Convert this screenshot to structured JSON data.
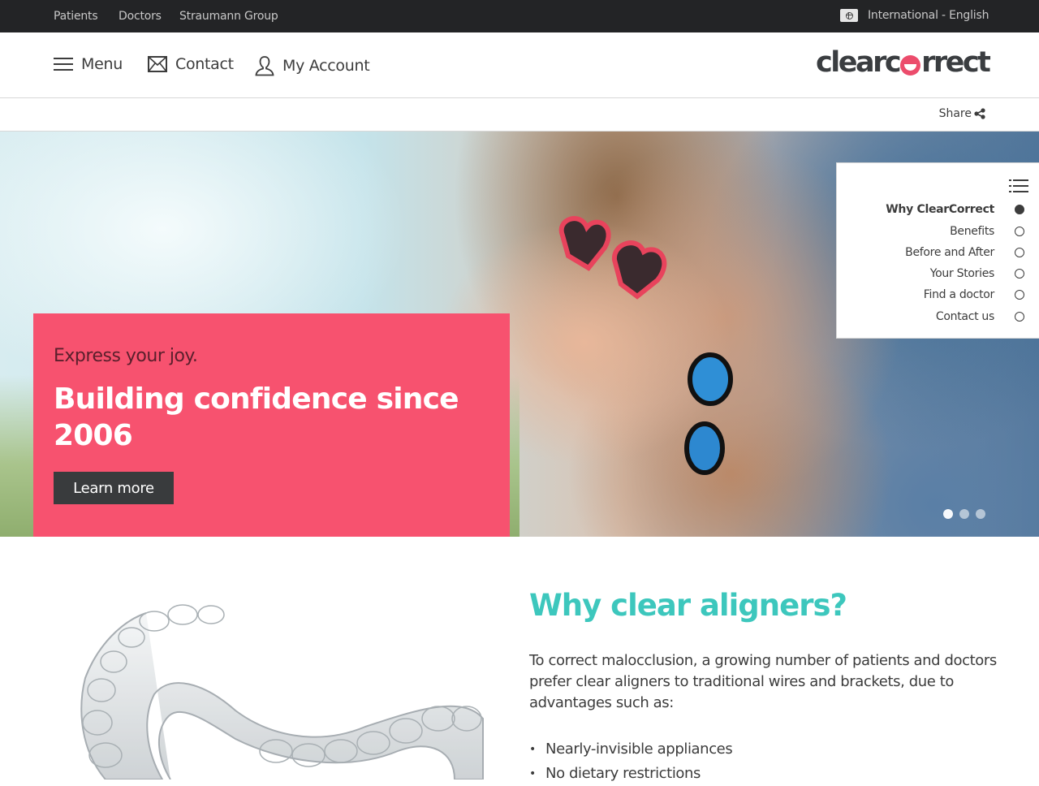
{
  "topbar": {
    "links": [
      "Patients",
      "Doctors",
      "Straumann Group"
    ],
    "language": "International - English"
  },
  "header": {
    "menu_label": "Menu",
    "contact_label": "Contact",
    "account_label": "My Account",
    "logo": {
      "part1": "clearc",
      "part2": "rrect"
    }
  },
  "share": {
    "label": "Share"
  },
  "hero": {
    "eyebrow": "Express your joy.",
    "title": "Building confidence since 2006",
    "cta_label": "Learn more",
    "slides": {
      "count": 3,
      "active_index": 0
    },
    "card_color": "#f7526f"
  },
  "anchor_nav": {
    "items": [
      {
        "label": "Why ClearCorrect",
        "active": true
      },
      {
        "label": "Benefits",
        "active": false
      },
      {
        "label": "Before and After",
        "active": false
      },
      {
        "label": "Your Stories",
        "active": false
      },
      {
        "label": "Find a doctor",
        "active": false
      },
      {
        "label": "Contact us",
        "active": false
      }
    ]
  },
  "why": {
    "title": "Why clear aligners?",
    "body": "To correct malocclusion, a growing number of patients and doctors prefer clear aligners to traditional wires and brackets, due to advantages such as:",
    "bullets": [
      "Nearly-invisible appliances",
      "No dietary restrictions"
    ],
    "accent_color": "#3dc7bd"
  }
}
